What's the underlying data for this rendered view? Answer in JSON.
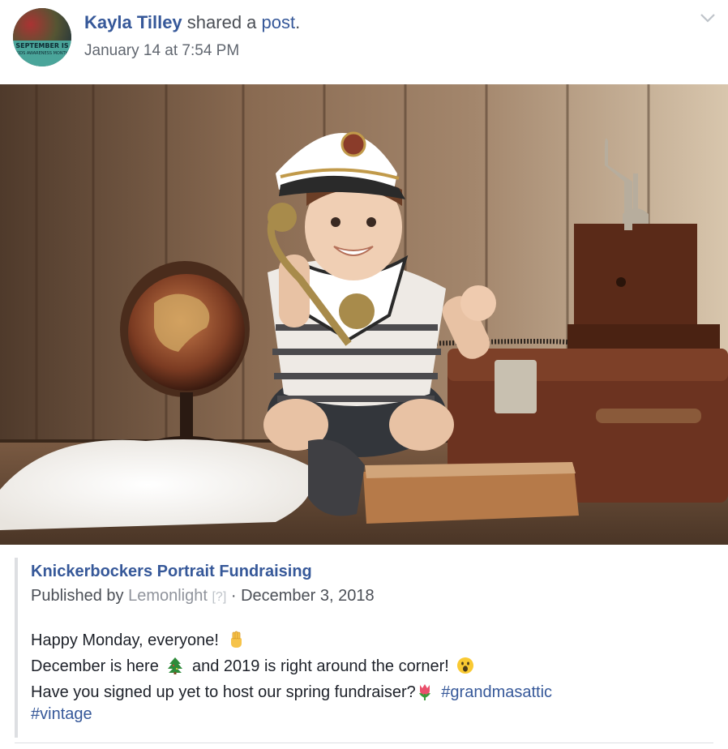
{
  "post": {
    "author": "Kayla Tilley",
    "action_text": " shared a ",
    "object_link": "post",
    "action_end": ".",
    "timestamp": "January 14 at 7:54 PM",
    "avatar_text_line1": "SEPTEMBER IS",
    "avatar_text_line2": "KIDS AWARENESS MONTH",
    "menu_icon": "chevron-down-icon"
  },
  "shared": {
    "page_name": "Knickerbockers Portrait Fundraising",
    "published_by_label": "Published by ",
    "publisher": "Lemonlight",
    "help_marker": "[?]",
    "separator": " · ",
    "date": "December 3, 2018",
    "line1": "Happy Monday, everyone!",
    "line2_a": "December is here",
    "line2_b": "and 2019 is right around the corner!",
    "line3": "Have you signed up yet to host our spring fundraiser?",
    "hashtag1": "#grandmasattic",
    "hashtag2": "#vintage",
    "emojis": [
      "raised-fist-emoji",
      "christmas-tree-emoji",
      "surprised-face-emoji",
      "tulip-emoji"
    ]
  },
  "colors": {
    "link": "#365899",
    "meta_text": "#616770",
    "border": "#dddfe2"
  }
}
